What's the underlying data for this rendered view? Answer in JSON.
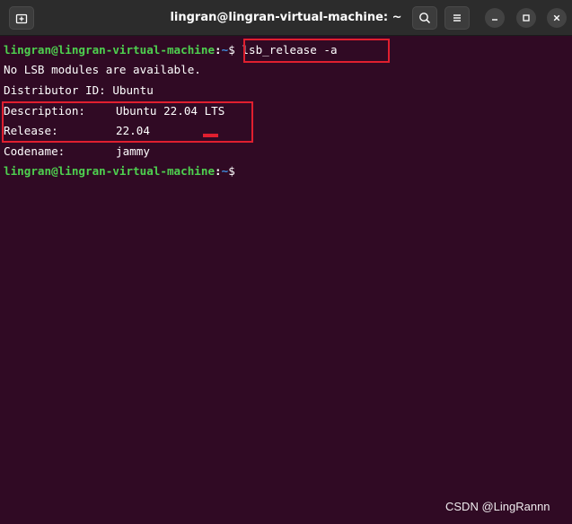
{
  "window": {
    "title": "lingran@lingran-virtual-machine: ~"
  },
  "colors": {
    "terminal_bg": "#300a24",
    "prompt_user": "#4ed04f",
    "prompt_path": "#3f8ee0",
    "highlight": "#e01f2f",
    "titlebar_bg": "#2c2c2c"
  },
  "icons": {
    "new_tab": "new-tab-icon",
    "search": "search-icon",
    "menu": "hamburger-menu-icon",
    "minimize": "minimize-icon",
    "maximize": "maximize-icon",
    "close": "close-icon"
  },
  "terminal": {
    "prompt": {
      "user_host": "lingran@lingran-virtual-machine",
      "colon": ":",
      "path": "~",
      "dollar": "$"
    },
    "command": " lsb_release -a",
    "output": {
      "no_lsb": "No LSB modules are available.",
      "distributor": "Distributor ID: Ubuntu",
      "description_label": "Description:",
      "description_value": "Ubuntu 22.04 LTS",
      "release_label": "Release:",
      "release_value": "22.04",
      "codename_label": "Codename:",
      "codename_value": "jammy"
    }
  },
  "watermark": "CSDN @LingRannn"
}
